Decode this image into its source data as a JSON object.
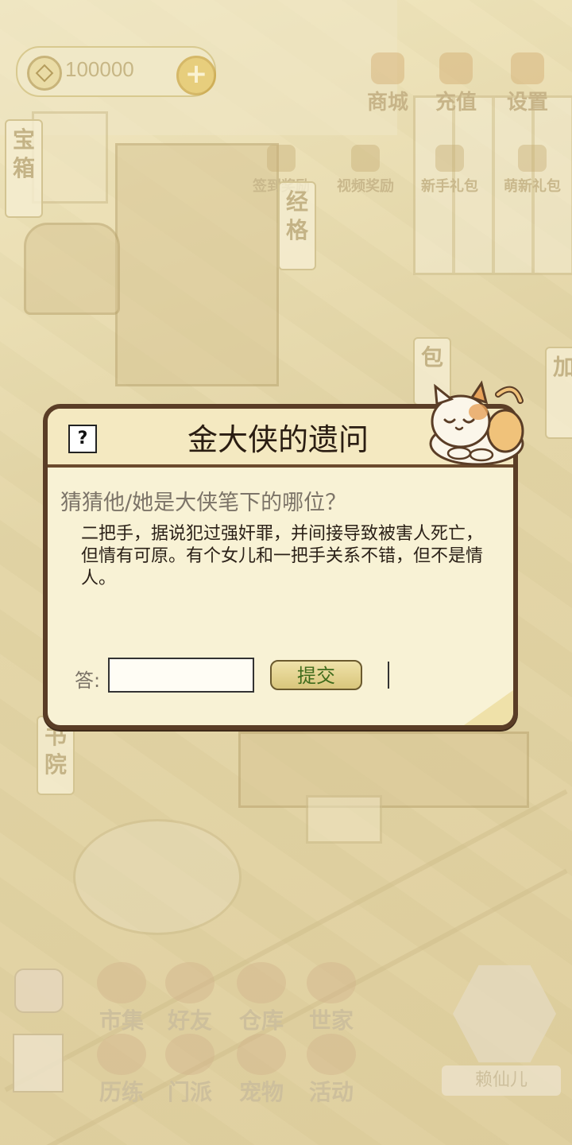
{
  "hud": {
    "coins": "100000",
    "top_buttons": [
      "商城",
      "充值",
      "设置"
    ],
    "rewards": [
      "签到奖励",
      "视频奖励",
      "新手礼包",
      "萌新礼包"
    ],
    "side_tags": [
      "宝箱",
      "经格",
      "包",
      "加",
      "书院"
    ]
  },
  "dialog": {
    "help_label": "?",
    "title": "金大侠的遗问",
    "question": "猜猜他/她是大侠笔下的哪位？",
    "clue": "二把手，据说犯过强奸罪，并间接导致被害人死亡，但情有可原。有个女儿和一把手关系不错，但不是情人。",
    "answer_label": "答:",
    "answer_value": "",
    "submit_label": "提交"
  },
  "bottom_menu": [
    "市集",
    "好友",
    "仓库",
    "世家",
    "历练",
    "门派",
    "宠物",
    "活动"
  ],
  "player": {
    "name": "赖仙儿"
  }
}
